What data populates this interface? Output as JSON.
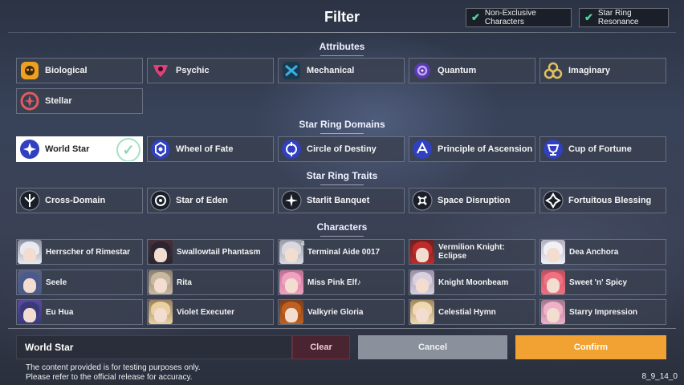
{
  "header": {
    "title": "Filter",
    "toggles": [
      {
        "label": "Non-Exclusive Characters",
        "checked": true
      },
      {
        "label": "Star Ring Resonance",
        "checked": true
      }
    ]
  },
  "attributes": {
    "title": "Attributes",
    "items": [
      {
        "label": "Biological",
        "icon": "biological-icon",
        "color": "#f0a020"
      },
      {
        "label": "Psychic",
        "icon": "psychic-icon",
        "color": "#e0407a"
      },
      {
        "label": "Mechanical",
        "icon": "mechanical-icon",
        "color": "#3ab0e0"
      },
      {
        "label": "Quantum",
        "icon": "quantum-icon",
        "color": "#7a50d8"
      },
      {
        "label": "Imaginary",
        "icon": "imaginary-icon",
        "color": "#e0c060"
      },
      {
        "label": "Stellar",
        "icon": "stellar-icon",
        "color": "#e05a60"
      }
    ]
  },
  "domains": {
    "title": "Star Ring Domains",
    "items": [
      {
        "label": "World Star",
        "selected": true
      },
      {
        "label": "Wheel of Fate",
        "selected": false
      },
      {
        "label": "Circle of Destiny",
        "selected": false
      },
      {
        "label": "Principle of Ascension",
        "selected": false
      },
      {
        "label": "Cup of Fortune",
        "selected": false
      }
    ]
  },
  "traits": {
    "title": "Star Ring Traits",
    "items": [
      {
        "label": "Cross-Domain"
      },
      {
        "label": "Star of Eden"
      },
      {
        "label": "Starlit Banquet"
      },
      {
        "label": "Space Disruption"
      },
      {
        "label": "Fortuitous Blessing"
      }
    ]
  },
  "characters": {
    "title": "Characters",
    "items": [
      {
        "label": "Herrscher of Rimestar",
        "hair": "#e8eaf0",
        "bg": "#8a8fa0"
      },
      {
        "label": "Swallowtail Phantasm",
        "hair": "#2a2530",
        "bg": "#4a3038"
      },
      {
        "label": "Terminal Aide 0017",
        "hair": "#d8d8e0",
        "bg": "#9a9aa8",
        "badge": "4"
      },
      {
        "label": "Vermilion Knight: Eclipse",
        "hair": "#c02a2a",
        "bg": "#6a2020"
      },
      {
        "label": "Dea Anchora",
        "hair": "#f0f0f5",
        "bg": "#b0b0c0"
      },
      {
        "label": "Seele",
        "hair": "#4a5a8a",
        "bg": "#5a6080"
      },
      {
        "label": "Rita",
        "hair": "#c8b8a0",
        "bg": "#8a8070"
      },
      {
        "label": "Miss Pink Elf♪",
        "hair": "#f0a0c0",
        "bg": "#c07090"
      },
      {
        "label": "Knight Moonbeam",
        "hair": "#d8d0e0",
        "bg": "#9a90a8"
      },
      {
        "label": "Sweet 'n' Spicy",
        "hair": "#f07080",
        "bg": "#c05060"
      },
      {
        "label": "Eu Hua",
        "hair": "#3a3a7a",
        "bg": "#5a4a9a"
      },
      {
        "label": "Violet Executer",
        "hair": "#e8d0a0",
        "bg": "#9a8060"
      },
      {
        "label": "Valkyrie Gloria",
        "hair": "#c06020",
        "bg": "#7a4020"
      },
      {
        "label": "Celestial Hymn",
        "hair": "#f0d8b0",
        "bg": "#a08860"
      },
      {
        "label": "Starry Impression",
        "hair": "#f0b0c8",
        "bg": "#a07890"
      }
    ]
  },
  "footer": {
    "selected_value": "World Star",
    "clear_label": "Clear",
    "cancel_label": "Cancel",
    "confirm_label": "Confirm",
    "disclaimer_line1": "The content provided is for testing purposes only.",
    "disclaimer_line2": "Please refer to the official release for accuracy.",
    "version": "8_9_14_0"
  },
  "colors": {
    "accent_confirm": "#f2a232",
    "clear_bg": "#4a2430",
    "check_color": "#4fd6a5",
    "domain_icon_bg": "#3040c0"
  }
}
